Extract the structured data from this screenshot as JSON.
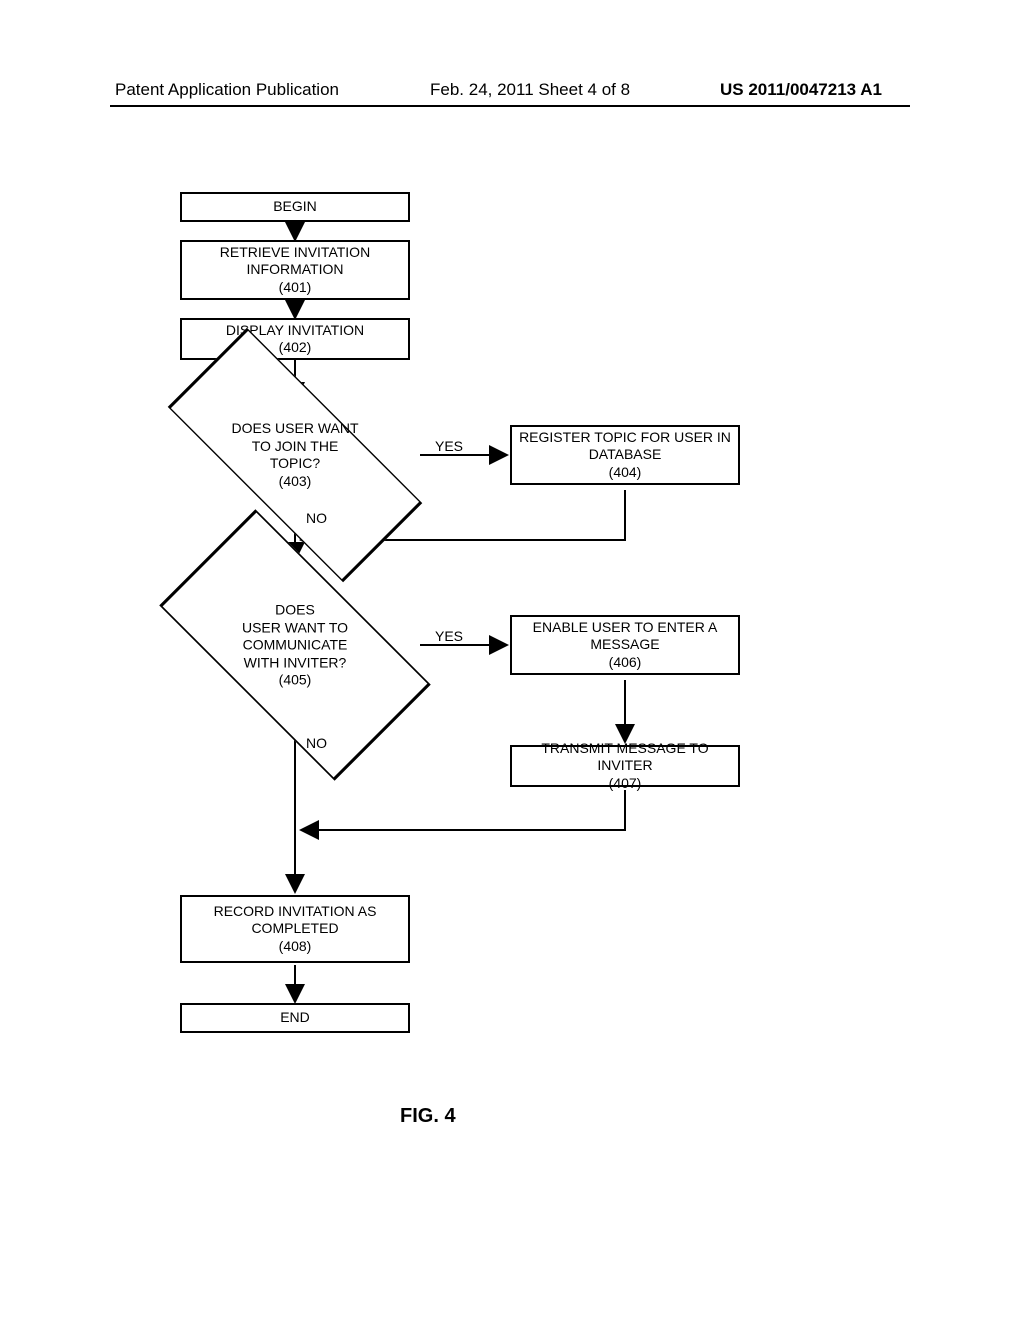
{
  "header": {
    "left": "Patent Application Publication",
    "center": "Feb. 24, 2011  Sheet 4 of 8",
    "right": "US 2011/0047213 A1"
  },
  "figure_label": "FIG. 4",
  "nodes": {
    "begin": "BEGIN",
    "step401_l1": "RETRIEVE INVITATION",
    "step401_l2": "INFORMATION",
    "step401_l3": "(401)",
    "step402_l1": "DISPLAY INVITATION",
    "step402_l2": "(402)",
    "dec403_l1": "DOES USER WANT",
    "dec403_l2": "TO JOIN THE",
    "dec403_l3": "TOPIC?",
    "dec403_l4": "(403)",
    "step404_l1": "REGISTER TOPIC FOR USER IN",
    "step404_l2": "DATABASE",
    "step404_l3": "(404)",
    "dec405_l1": "DOES",
    "dec405_l2": "USER WANT TO",
    "dec405_l3": "COMMUNICATE",
    "dec405_l4": "WITH INVITER?",
    "dec405_l5": "(405)",
    "step406_l1": "ENABLE USER TO ENTER A",
    "step406_l2": "MESSAGE",
    "step406_l3": "(406)",
    "step407_l1": "TRANSMIT MESSAGE TO INVITER",
    "step407_l2": "(407)",
    "step408_l1": "RECORD INVITATION AS",
    "step408_l2": "COMPLETED",
    "step408_l3": "(408)",
    "end": "END"
  },
  "edges": {
    "yes": "YES",
    "no": "NO"
  },
  "chart_data": {
    "type": "flowchart",
    "title": "FIG. 4",
    "nodes": [
      {
        "id": "begin",
        "type": "terminator",
        "label": "BEGIN"
      },
      {
        "id": "401",
        "type": "process",
        "label": "RETRIEVE INVITATION INFORMATION (401)"
      },
      {
        "id": "402",
        "type": "process",
        "label": "DISPLAY INVITATION (402)"
      },
      {
        "id": "403",
        "type": "decision",
        "label": "DOES USER WANT TO JOIN THE TOPIC? (403)"
      },
      {
        "id": "404",
        "type": "process",
        "label": "REGISTER TOPIC FOR USER IN DATABASE (404)"
      },
      {
        "id": "405",
        "type": "decision",
        "label": "DOES USER WANT TO COMMUNICATE WITH INVITER? (405)"
      },
      {
        "id": "406",
        "type": "process",
        "label": "ENABLE USER TO ENTER A MESSAGE (406)"
      },
      {
        "id": "407",
        "type": "process",
        "label": "TRANSMIT MESSAGE TO INVITER (407)"
      },
      {
        "id": "408",
        "type": "process",
        "label": "RECORD INVITATION AS COMPLETED (408)"
      },
      {
        "id": "end",
        "type": "terminator",
        "label": "END"
      }
    ],
    "edges": [
      {
        "from": "begin",
        "to": "401"
      },
      {
        "from": "401",
        "to": "402"
      },
      {
        "from": "402",
        "to": "403"
      },
      {
        "from": "403",
        "to": "404",
        "label": "YES"
      },
      {
        "from": "403",
        "to": "405",
        "label": "NO"
      },
      {
        "from": "404",
        "to": "405"
      },
      {
        "from": "405",
        "to": "406",
        "label": "YES"
      },
      {
        "from": "405",
        "to": "408",
        "label": "NO"
      },
      {
        "from": "406",
        "to": "407"
      },
      {
        "from": "407",
        "to": "408"
      },
      {
        "from": "408",
        "to": "end"
      }
    ]
  }
}
